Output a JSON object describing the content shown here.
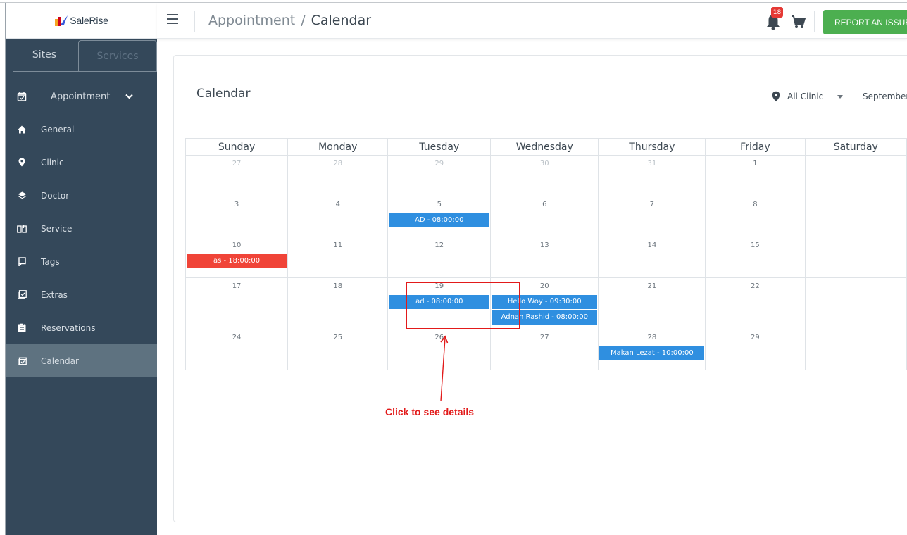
{
  "brand": {
    "name": "SaleRise"
  },
  "sidebar": {
    "tabs": [
      {
        "label": "Sites",
        "active": true
      },
      {
        "label": "Services",
        "active": false
      }
    ],
    "section": {
      "label": "Appointment",
      "icon": "calendar-check-icon"
    },
    "items": [
      {
        "label": "General",
        "icon": "home-icon"
      },
      {
        "label": "Clinic",
        "icon": "location-pin-icon"
      },
      {
        "label": "Doctor",
        "icon": "layers-icon"
      },
      {
        "label": "Service",
        "icon": "book-icon"
      },
      {
        "label": "Tags",
        "icon": "tag-icon"
      },
      {
        "label": "Extras",
        "icon": "checklist-icon"
      },
      {
        "label": "Reservations",
        "icon": "clipboard-icon"
      },
      {
        "label": "Calendar",
        "icon": "calendar-icon",
        "active": true
      }
    ]
  },
  "topbar": {
    "breadcrumb": {
      "parent": "Appointment",
      "separator": "/",
      "current": "Calendar"
    },
    "notifications": {
      "count": "18"
    },
    "report_button": "REPORT AN ISSUE"
  },
  "page": {
    "title": "Calendar",
    "filters": {
      "clinic": "All Clinic",
      "month": "September"
    }
  },
  "calendar": {
    "days": [
      "Sunday",
      "Monday",
      "Tuesday",
      "Wednesday",
      "Thursday",
      "Friday",
      "Saturday"
    ],
    "weeks": [
      [
        {
          "d": "27",
          "muted": true,
          "events": []
        },
        {
          "d": "28",
          "muted": true,
          "events": []
        },
        {
          "d": "29",
          "muted": true,
          "events": []
        },
        {
          "d": "30",
          "muted": true,
          "events": []
        },
        {
          "d": "31",
          "muted": true,
          "events": []
        },
        {
          "d": "1",
          "events": []
        },
        {
          "d": "",
          "events": []
        }
      ],
      [
        {
          "d": "3",
          "events": []
        },
        {
          "d": "4",
          "events": []
        },
        {
          "d": "5",
          "events": [
            {
              "label": "AD - 08:00:00",
              "color": "blue"
            }
          ]
        },
        {
          "d": "6",
          "events": []
        },
        {
          "d": "7",
          "events": []
        },
        {
          "d": "8",
          "events": []
        },
        {
          "d": "",
          "events": []
        }
      ],
      [
        {
          "d": "10",
          "events": [
            {
              "label": "as - 18:00:00",
              "color": "red"
            }
          ]
        },
        {
          "d": "11",
          "events": []
        },
        {
          "d": "12",
          "events": []
        },
        {
          "d": "13",
          "events": []
        },
        {
          "d": "14",
          "events": []
        },
        {
          "d": "15",
          "events": []
        },
        {
          "d": "",
          "events": []
        }
      ],
      [
        {
          "d": "17",
          "events": []
        },
        {
          "d": "18",
          "events": []
        },
        {
          "d": "19",
          "events": [
            {
              "label": "ad - 08:00:00",
              "color": "blue"
            }
          ]
        },
        {
          "d": "20",
          "events": [
            {
              "label": "Hello Woy - 09:30:00",
              "color": "blue"
            },
            {
              "label": "Adnan Rashid - 08:00:00",
              "color": "blue"
            }
          ]
        },
        {
          "d": "21",
          "events": []
        },
        {
          "d": "22",
          "events": []
        },
        {
          "d": "",
          "events": []
        }
      ],
      [
        {
          "d": "24",
          "events": []
        },
        {
          "d": "25",
          "events": []
        },
        {
          "d": "26",
          "events": []
        },
        {
          "d": "27",
          "events": []
        },
        {
          "d": "28",
          "events": [
            {
              "label": "Makan Lezat - 10:00:00",
              "color": "blue"
            }
          ]
        },
        {
          "d": "29",
          "events": []
        },
        {
          "d": "",
          "events": []
        }
      ]
    ]
  },
  "annotation": {
    "text": "Click to see details"
  },
  "colors": {
    "sidebar": "#34485a",
    "active_item": "#5e7280",
    "event_blue": "#2f8fe0",
    "event_red": "#f04438",
    "report_button": "#4caf50",
    "annotation": "#e21a1a"
  }
}
